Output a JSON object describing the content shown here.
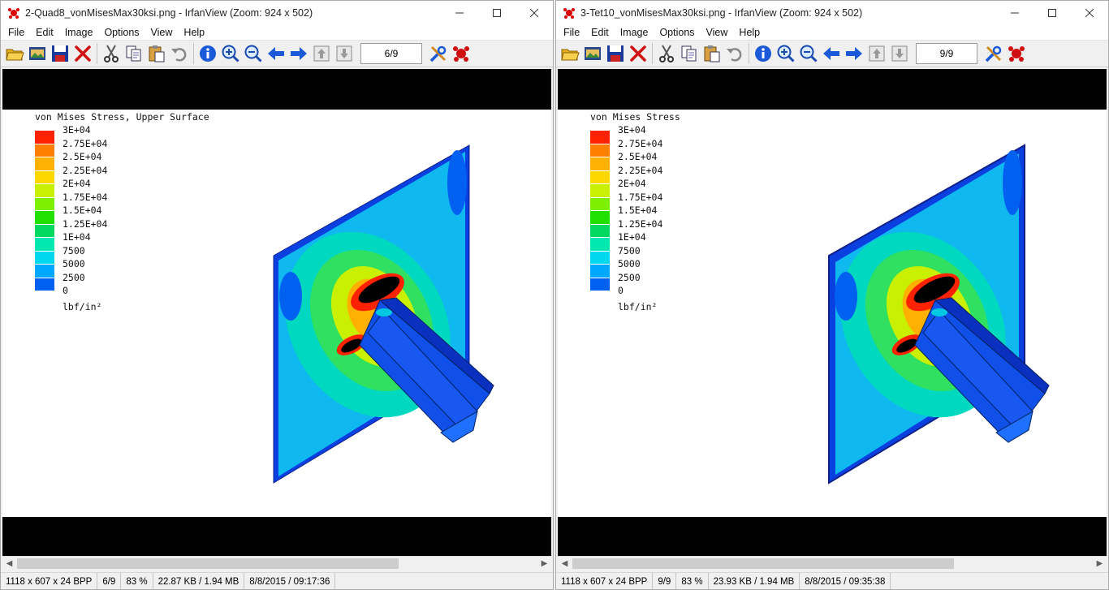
{
  "colors": {
    "legend": [
      "#ff2200",
      "#ff8000",
      "#ffb000",
      "#ffd800",
      "#c8f000",
      "#7cf000",
      "#20e000",
      "#00d860",
      "#00e8b0",
      "#00d8f0",
      "#00a8ff",
      "#0060f0",
      "#0020e8"
    ]
  },
  "windows": [
    {
      "title": "2-Quad8_vonMisesMax30ksi.png - IrfanView (Zoom: 924 x 502)",
      "page_box": "6/9",
      "legend_title": "von Mises Stress, Upper Surface",
      "legend_unit": "lbf/in²",
      "status": {
        "dims": "1118 x 607 x 24 BPP",
        "page": "6/9",
        "zoom": "83 %",
        "size": "22.87 KB / 1.94 MB",
        "datetime": "8/8/2015 / 09:17:36"
      }
    },
    {
      "title": "3-Tet10_vonMisesMax30ksi.png - IrfanView (Zoom: 924 x 502)",
      "page_box": "9/9",
      "legend_title": "von Mises Stress",
      "legend_unit": "lbf/in²",
      "status": {
        "dims": "1118 x 607 x 24 BPP",
        "page": "9/9",
        "zoom": "83 %",
        "size": "23.93 KB / 1.94 MB",
        "datetime": "8/8/2015 / 09:35:38"
      }
    }
  ],
  "menu": [
    "File",
    "Edit",
    "Image",
    "Options",
    "View",
    "Help"
  ],
  "legend_labels": [
    "3E+04",
    "2.75E+04",
    "2.5E+04",
    "2.25E+04",
    "2E+04",
    "1.75E+04",
    "1.5E+04",
    "1.25E+04",
    "1E+04",
    "7500",
    "5000",
    "2500",
    "0"
  ],
  "icons": {
    "toolbar": [
      "open-folder-icon",
      "thumbnails-icon",
      "save-icon",
      "delete-icon",
      "cut-icon",
      "copy-icon",
      "paste-icon",
      "undo-icon",
      "info-icon",
      "zoom-in-icon",
      "zoom-out-icon",
      "previous-icon",
      "next-icon",
      "first-page-icon",
      "last-page-icon",
      "settings-icon",
      "irfanview-icon"
    ]
  }
}
